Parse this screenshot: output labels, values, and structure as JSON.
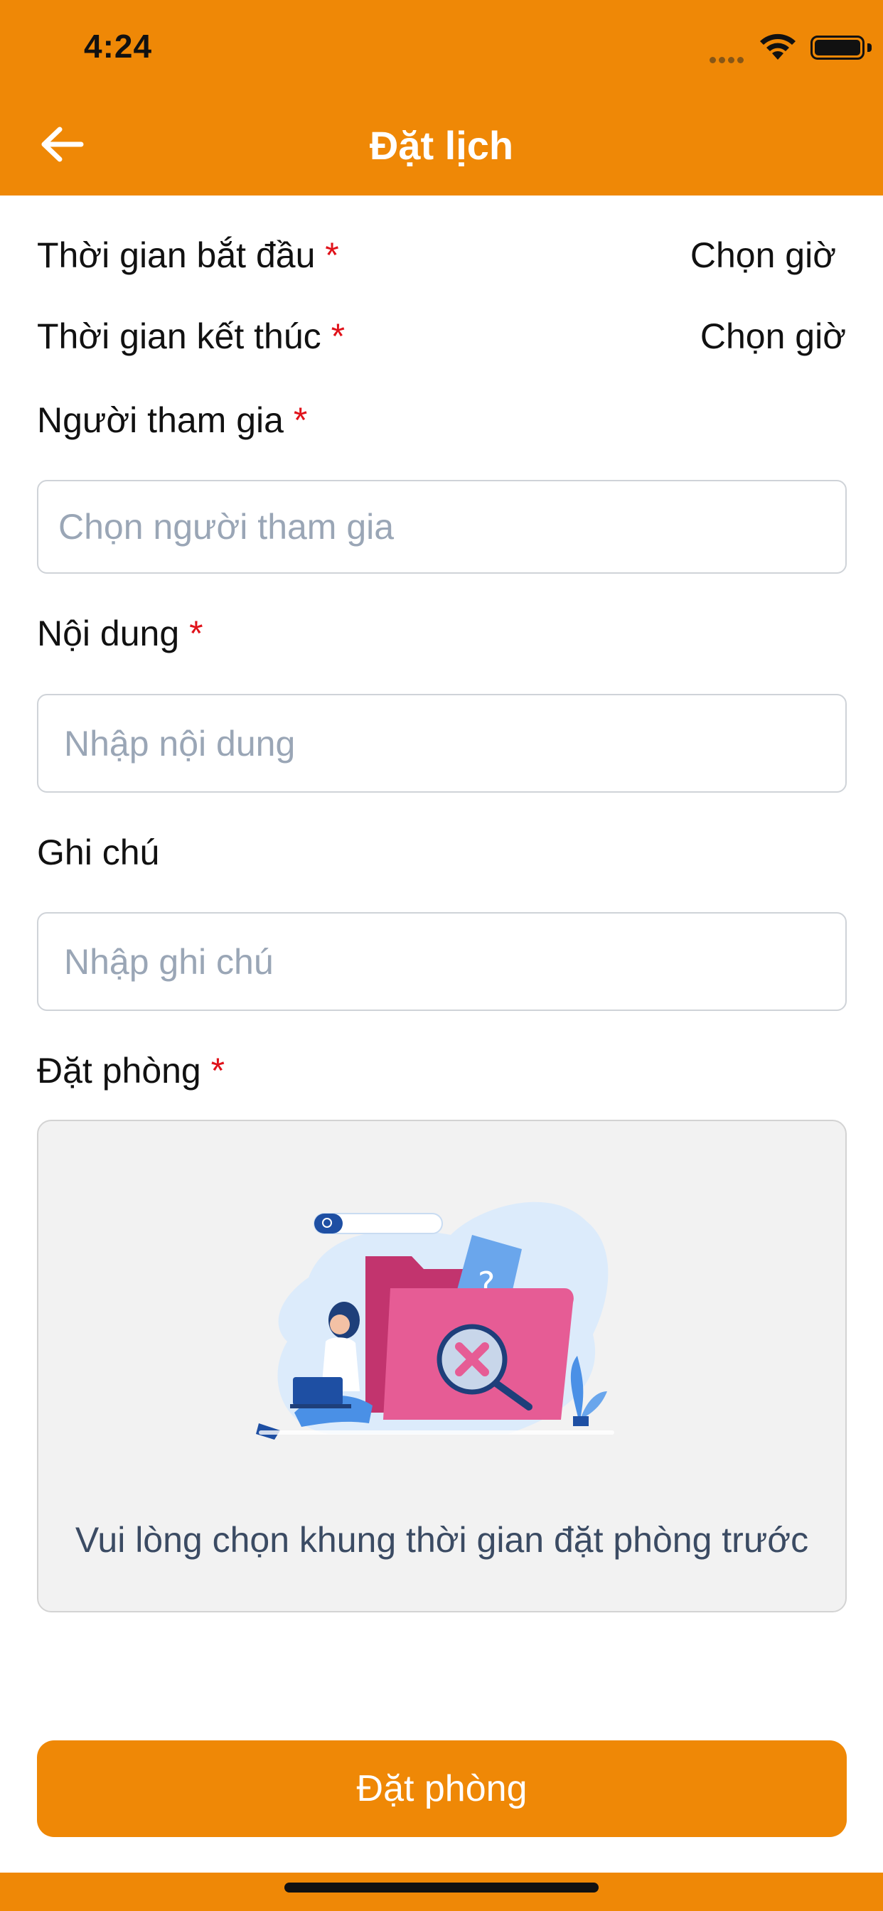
{
  "status_bar": {
    "time": "4:24"
  },
  "header": {
    "title": "Đặt lịch"
  },
  "form": {
    "start_time": {
      "label": "Thời gian bắt đầu",
      "required_mark": "*",
      "value": "Chọn giờ"
    },
    "end_time": {
      "label": "Thời gian kết thúc",
      "required_mark": "*",
      "value": "Chọn giờ"
    },
    "participants": {
      "label": "Người tham gia",
      "required_mark": "*",
      "placeholder": "Chọn người tham gia"
    },
    "content": {
      "label": "Nội dung",
      "required_mark": "*",
      "placeholder": "Nhập nội dung"
    },
    "note": {
      "label": "Ghi chú",
      "placeholder": "Nhập ghi chú"
    },
    "room": {
      "label": "Đặt phòng",
      "required_mark": "*",
      "empty_message": "Vui lòng chọn khung thời gian đặt phòng trước"
    }
  },
  "submit": {
    "label": "Đặt phòng"
  },
  "colors": {
    "accent": "#ef8806",
    "required": "#e0121a",
    "placeholder": "#9aa6b6"
  },
  "icons": {
    "back": "arrow-left-icon",
    "wifi": "wifi-icon",
    "battery": "battery-icon"
  }
}
